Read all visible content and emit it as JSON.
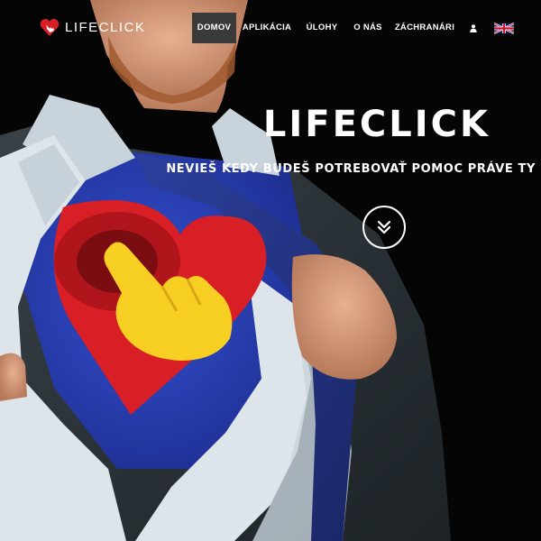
{
  "brand": {
    "name": "LIFECLICK",
    "logo_icon": "heart-click-logo-icon"
  },
  "nav": {
    "items": [
      {
        "label": "DOMOV",
        "active": true
      },
      {
        "label": "APLIKÁCIA",
        "active": false
      },
      {
        "label": "ÚLOHY",
        "active": false
      },
      {
        "label": "O NÁS",
        "active": false
      },
      {
        "label": "ZÁCHRANÁRI",
        "active": false
      }
    ],
    "user_icon": "user-icon",
    "language_icon": "uk-flag-icon"
  },
  "hero": {
    "title": "LIFECLICK",
    "subtitle": "NEVIEŠ KEDY BUDEŠ POTREBOVAŤ POMOC PRÁVE TY",
    "scroll_icon": "double-chevron-down-icon"
  },
  "colors": {
    "background": "#050505",
    "nav_active": "#3a3a3a",
    "heart_red": "#d81f26",
    "shirt_blue": "#2a3fb0",
    "hand_yellow": "#f7cf23",
    "text": "#ffffff"
  }
}
